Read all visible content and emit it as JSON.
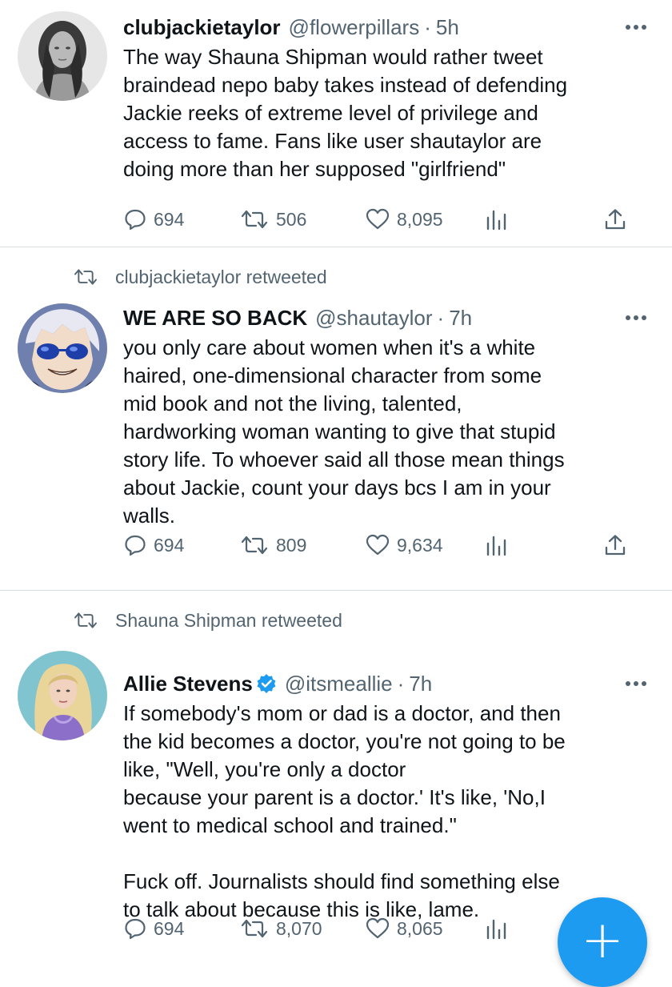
{
  "tweets": [
    {
      "display_name": "clubjackietaylor",
      "handle": "@flowerpillars",
      "separator": "·",
      "time": "5h",
      "text": "The way Shauna Shipman would rather tweet\nbraindead nepo baby takes instead of defending\nJackie reeks of extreme level of privilege and\naccess to fame. Fans like user shautaylor are\ndoing more than her supposed \"girlfriend\"",
      "replies": "694",
      "retweets": "506",
      "likes": "8,095",
      "avatar_icon": "woman-portrait-grayscale"
    },
    {
      "retweet_banner": "clubjackietaylor retweeted",
      "display_name": "WE ARE SO BACK",
      "handle": "@shautaylor",
      "separator": "·",
      "time": "7h",
      "text": "you only care about women when it's a white\nhaired, one-dimensional character from some\nmid book and not the living, talented,\nhardworking woman wanting to give that stupid\nstory life. To whoever said all those mean things\nabout Jackie, count your days bcs I am in your\nwalls.",
      "replies": "694",
      "retweets": "809",
      "likes": "9,634",
      "avatar_icon": "anime-character-white-hair-blue-glasses"
    },
    {
      "retweet_banner": "Shauna Shipman retweeted",
      "display_name": "Allie Stevens",
      "verified": true,
      "handle": "@itsmeallie",
      "separator": "·",
      "time": "7h",
      "text": "If somebody's mom or dad is a doctor, and then\nthe kid becomes a doctor, you're not going to be\nlike, \"Well, you're only a doctor\nbecause your parent is a doctor.' It's like, 'No,I\nwent to medical school and trained.\"\n\nFuck off. Journalists should find something else\nto talk about because this is like, lame.",
      "replies": "694",
      "retweets": "8,070",
      "likes": "8,065",
      "avatar_icon": "blonde-woman-portrait-blue-background"
    }
  ],
  "fab": {
    "label": "+",
    "icon": "compose-plus-icon"
  },
  "colors": {
    "text": "#0f1419",
    "secondary": "#536471",
    "divider": "#d9dee2",
    "accent": "#1d9bf0"
  }
}
